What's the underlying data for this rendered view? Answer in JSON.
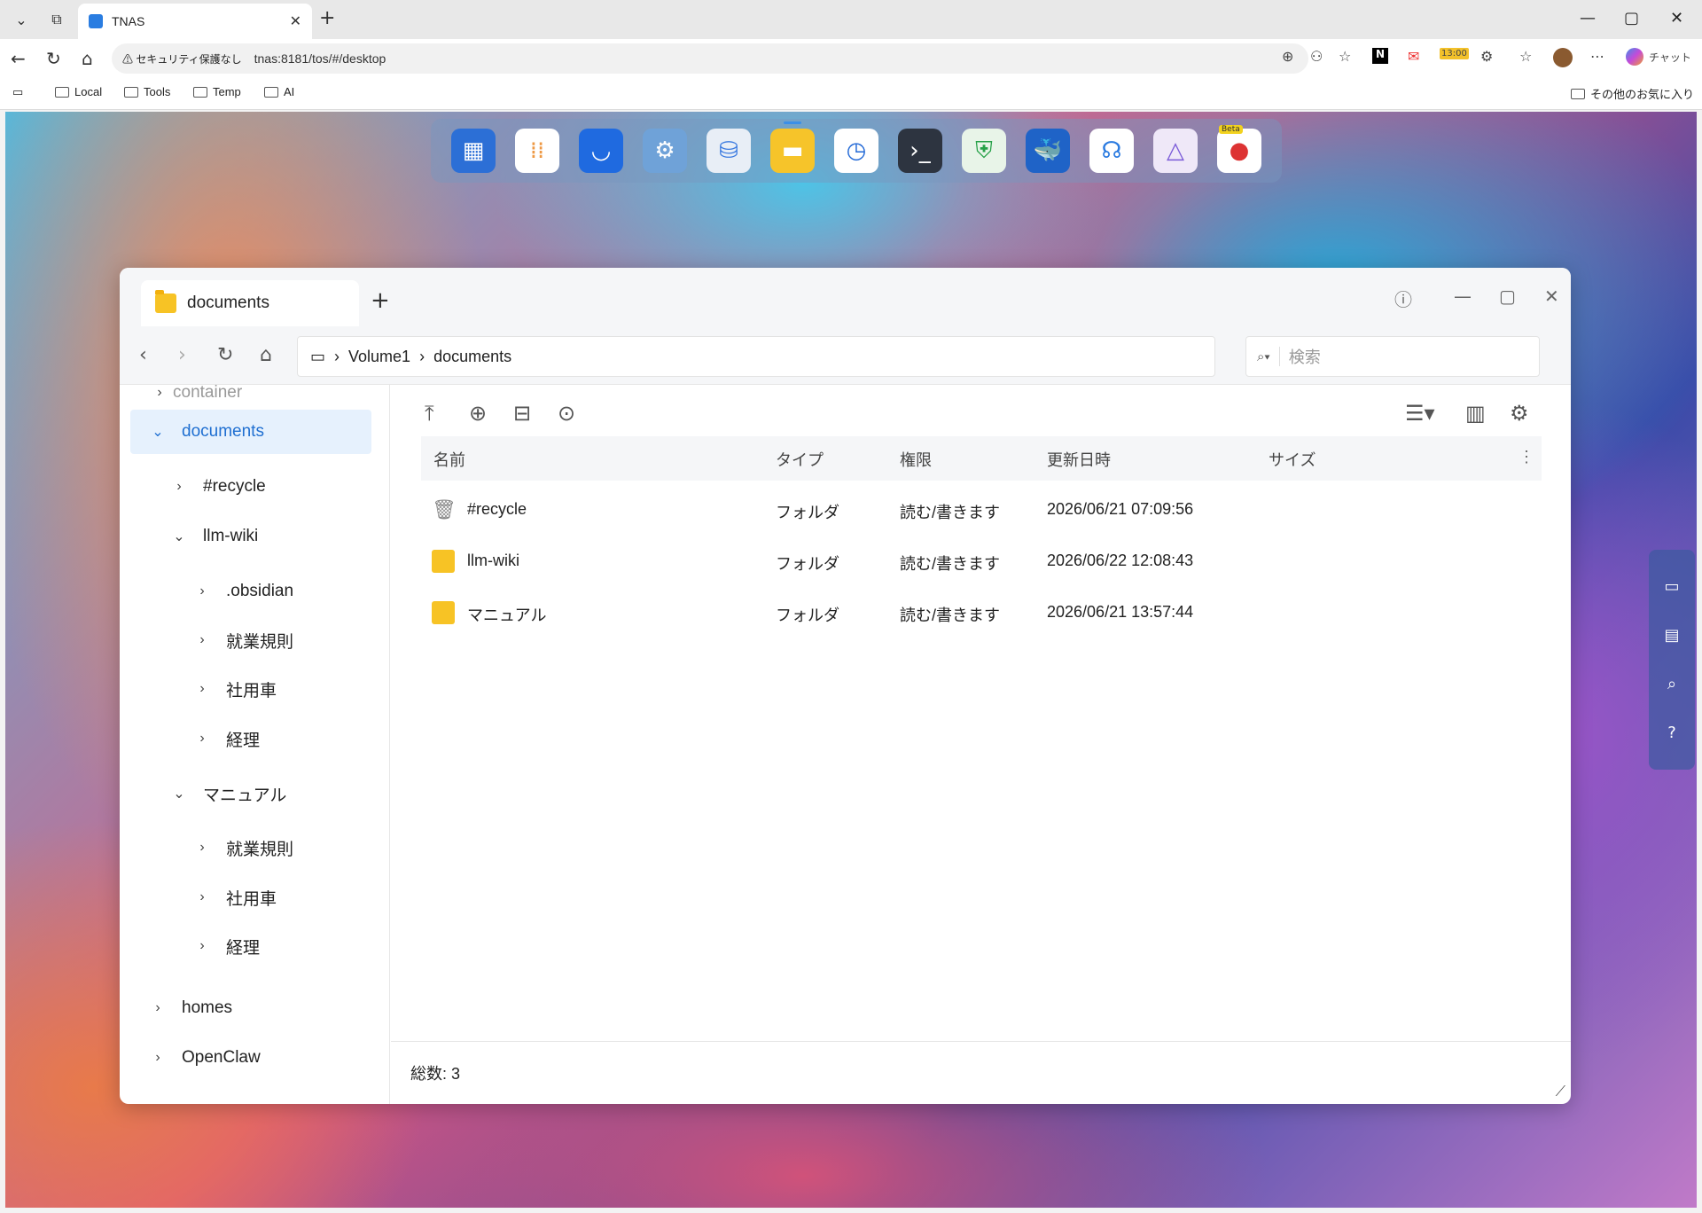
{
  "browser": {
    "tab_title": "TNAS",
    "security_label": "セキュリティ保護なし",
    "url": "tnas:8181/tos/#/desktop",
    "chat_label": "チャット",
    "time_badge": "13:00",
    "bookmarks": [
      "Local",
      "Tools",
      "Temp",
      "AI"
    ],
    "other_bookmarks": "その他のお気に入り"
  },
  "dock": {
    "apps": [
      "control-panel",
      "app-center",
      "store",
      "settings",
      "storage",
      "file-manager",
      "backup",
      "terminal",
      "security",
      "docker",
      "support",
      "tunnel",
      "beta-app"
    ],
    "beta_label": "Beta"
  },
  "window": {
    "tab_title": "documents",
    "path": [
      "Volume1",
      "documents"
    ],
    "search_placeholder": "検索"
  },
  "tree": {
    "partial_top": "container",
    "items": [
      {
        "label": "documents"
      },
      {
        "label": "#recycle"
      },
      {
        "label": "llm-wiki"
      },
      {
        "label": ".obsidian"
      },
      {
        "label": "就業規則"
      },
      {
        "label": "社用車"
      },
      {
        "label": "経理"
      },
      {
        "label": "マニュアル"
      },
      {
        "label": "就業規則"
      },
      {
        "label": "社用車"
      },
      {
        "label": "経理"
      },
      {
        "label": "homes"
      },
      {
        "label": "OpenClaw"
      }
    ]
  },
  "table": {
    "headers": [
      "名前",
      "タイプ",
      "権限",
      "更新日時",
      "サイズ"
    ],
    "rows": [
      {
        "name": "#recycle",
        "type": "フォルダ",
        "perm": "読む/書きます",
        "date": "2026/06/21 07:09:56",
        "icon": "trash-icon"
      },
      {
        "name": "llm-wiki",
        "type": "フォルダ",
        "perm": "読む/書きます",
        "date": "2026/06/22 12:08:43",
        "icon": "folder-icon"
      },
      {
        "name": "マニュアル",
        "type": "フォルダ",
        "perm": "読む/書きます",
        "date": "2026/06/21 13:57:44",
        "icon": "folder-icon"
      }
    ]
  },
  "footer": {
    "total": "総数: 3"
  }
}
